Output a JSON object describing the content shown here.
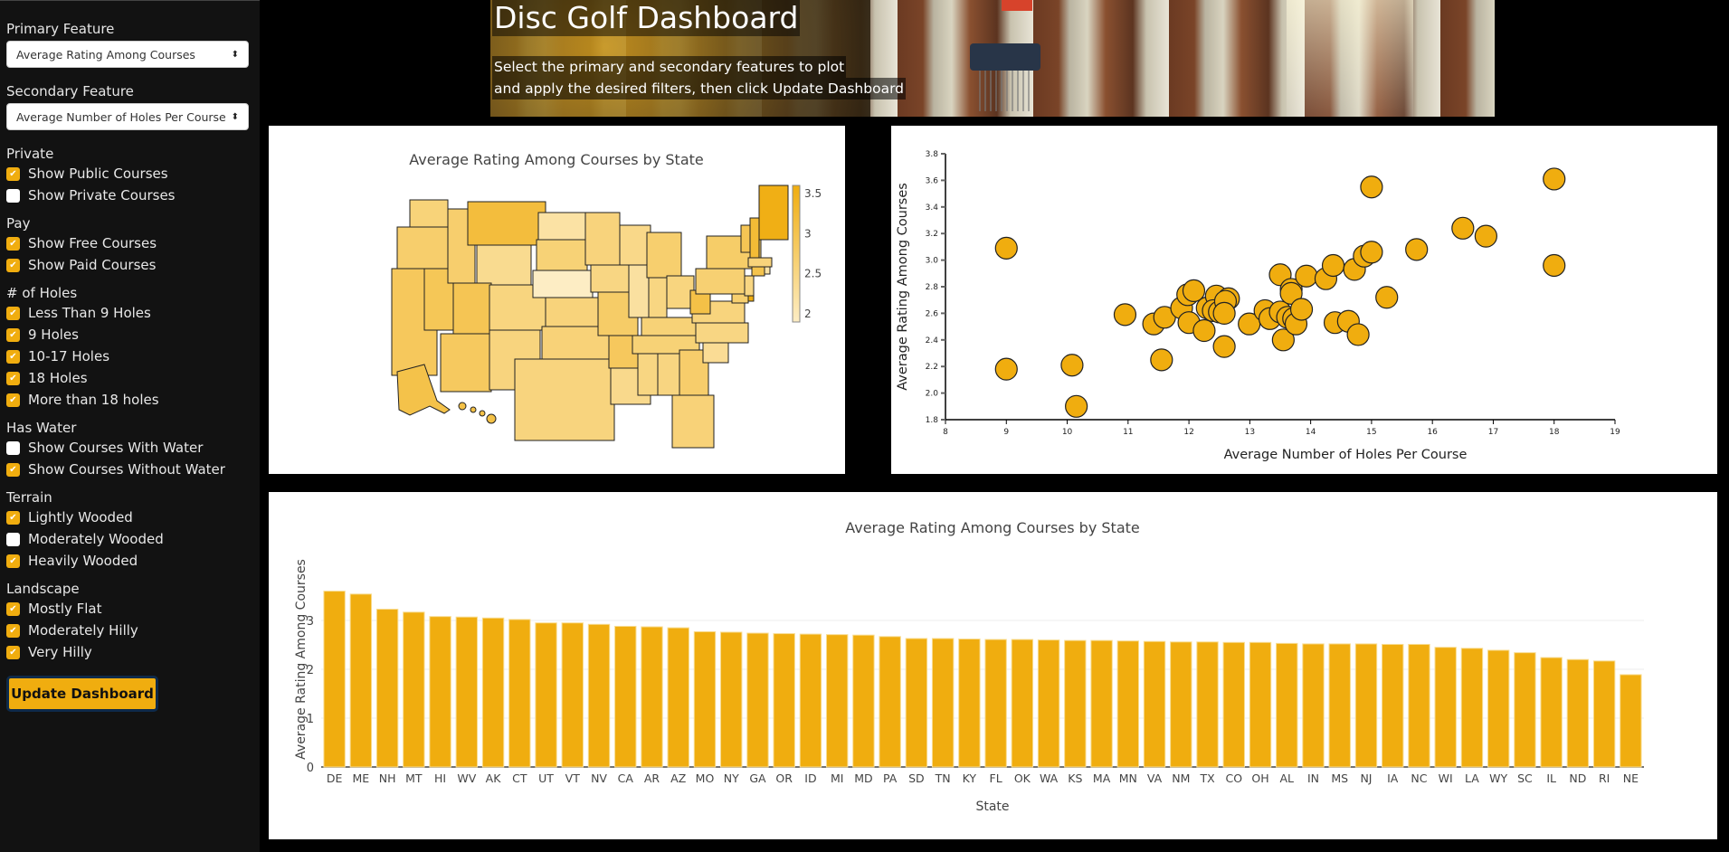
{
  "sidebar": {
    "primary_label": "Primary Feature",
    "primary_value": "Average Rating Among Courses",
    "secondary_label": "Secondary Feature",
    "secondary_value": "Average Number of Holes Per Course",
    "groups": [
      {
        "label": "Private",
        "items": [
          {
            "label": "Show Public Courses",
            "checked": true
          },
          {
            "label": "Show Private Courses",
            "checked": false
          }
        ]
      },
      {
        "label": "Pay",
        "items": [
          {
            "label": "Show Free Courses",
            "checked": true
          },
          {
            "label": "Show Paid Courses",
            "checked": true
          }
        ]
      },
      {
        "label": "# of Holes",
        "items": [
          {
            "label": "Less Than 9 Holes",
            "checked": true
          },
          {
            "label": "9 Holes",
            "checked": true
          },
          {
            "label": "10-17 Holes",
            "checked": true
          },
          {
            "label": "18 Holes",
            "checked": true
          },
          {
            "label": "More than 18 holes",
            "checked": true
          }
        ]
      },
      {
        "label": "Has Water",
        "items": [
          {
            "label": "Show Courses With Water",
            "checked": false
          },
          {
            "label": "Show Courses Without Water",
            "checked": true
          }
        ]
      },
      {
        "label": "Terrain",
        "items": [
          {
            "label": "Lightly Wooded",
            "checked": true
          },
          {
            "label": "Moderately Wooded",
            "checked": false
          },
          {
            "label": "Heavily Wooded",
            "checked": true
          }
        ]
      },
      {
        "label": "Landscape",
        "items": [
          {
            "label": "Mostly Flat",
            "checked": true
          },
          {
            "label": "Moderately Hilly",
            "checked": true
          },
          {
            "label": "Very Hilly",
            "checked": true
          }
        ]
      }
    ],
    "update_button": "Update Dashboard"
  },
  "banner": {
    "title": "Disc Golf Dashboard",
    "subtitle_line1": "Select the primary and secondary features to plot",
    "subtitle_line2": "and apply the desired filters, then click Update Dashboard"
  },
  "colors": {
    "accent": "#f0ad0f",
    "map_low": "#fdedc4",
    "map_high": "#f0ad0f"
  },
  "chart_data": [
    {
      "type": "choropleth",
      "title": "Average Rating Among Courses by State",
      "colorbar": {
        "ticks": [
          "3.5",
          "3",
          "2.5",
          "2"
        ],
        "range": [
          1.9,
          3.6
        ]
      },
      "note": "US states colored by the same values as the bar chart"
    },
    {
      "type": "scatter",
      "title": "",
      "xlabel": "Average Number of Holes Per Course",
      "ylabel": "Average Rating Among Courses",
      "xlim": [
        8,
        19
      ],
      "ylim": [
        1.8,
        3.8
      ],
      "xticks": [
        "8",
        "9",
        "10",
        "11",
        "12",
        "13",
        "14",
        "15",
        "16",
        "17",
        "18",
        "19"
      ],
      "yticks": [
        "1.8",
        "2.0",
        "2.2",
        "2.4",
        "2.6",
        "2.8",
        "3.0",
        "3.2",
        "3.4",
        "3.6",
        "3.8"
      ],
      "points": [
        [
          9.0,
          3.09
        ],
        [
          9.0,
          2.18
        ],
        [
          10.08,
          2.21
        ],
        [
          10.15,
          1.9
        ],
        [
          10.95,
          2.59
        ],
        [
          11.42,
          2.52
        ],
        [
          11.55,
          2.25
        ],
        [
          11.6,
          2.57
        ],
        [
          11.88,
          2.64
        ],
        [
          11.98,
          2.74
        ],
        [
          12.08,
          2.77
        ],
        [
          12.0,
          2.53
        ],
        [
          12.25,
          2.47
        ],
        [
          12.3,
          2.64
        ],
        [
          12.45,
          2.73
        ],
        [
          12.4,
          2.62
        ],
        [
          12.5,
          2.61
        ],
        [
          12.65,
          2.71
        ],
        [
          12.6,
          2.69
        ],
        [
          12.58,
          2.6
        ],
        [
          12.58,
          2.35
        ],
        [
          12.99,
          2.52
        ],
        [
          13.25,
          2.62
        ],
        [
          13.33,
          2.56
        ],
        [
          13.5,
          2.89
        ],
        [
          13.5,
          2.61
        ],
        [
          13.55,
          2.4
        ],
        [
          13.62,
          2.57
        ],
        [
          13.68,
          2.78
        ],
        [
          13.68,
          2.75
        ],
        [
          13.72,
          2.56
        ],
        [
          13.76,
          2.52
        ],
        [
          13.85,
          2.63
        ],
        [
          13.93,
          2.88
        ],
        [
          14.25,
          2.86
        ],
        [
          14.37,
          2.96
        ],
        [
          14.4,
          2.53
        ],
        [
          14.62,
          2.54
        ],
        [
          14.72,
          2.93
        ],
        [
          14.78,
          2.44
        ],
        [
          14.88,
          3.03
        ],
        [
          15.0,
          3.06
        ],
        [
          15.0,
          3.55
        ],
        [
          15.25,
          2.72
        ],
        [
          15.74,
          3.08
        ],
        [
          16.5,
          3.24
        ],
        [
          16.88,
          3.18
        ],
        [
          18.0,
          3.61
        ],
        [
          18.0,
          2.96
        ]
      ]
    },
    {
      "type": "bar",
      "title": "Average Rating Among Courses by State",
      "xlabel": "State",
      "ylabel": "Average Rating Among Courses",
      "ylim": [
        0,
        3.75
      ],
      "yticks": [
        "0",
        "1",
        "2",
        "3"
      ],
      "categories": [
        "DE",
        "ME",
        "NH",
        "MT",
        "HI",
        "WV",
        "AK",
        "CT",
        "UT",
        "VT",
        "NV",
        "CA",
        "AR",
        "AZ",
        "MO",
        "NY",
        "GA",
        "OR",
        "ID",
        "MI",
        "MD",
        "PA",
        "SD",
        "TN",
        "KY",
        "FL",
        "OK",
        "WA",
        "KS",
        "MA",
        "MN",
        "VA",
        "NM",
        "TX",
        "CO",
        "OH",
        "AL",
        "IN",
        "MS",
        "NJ",
        "IA",
        "NC",
        "WI",
        "LA",
        "WY",
        "SC",
        "IL",
        "ND",
        "RI",
        "NE"
      ],
      "values": [
        3.6,
        3.54,
        3.23,
        3.17,
        3.08,
        3.07,
        3.05,
        3.02,
        2.95,
        2.95,
        2.92,
        2.88,
        2.87,
        2.85,
        2.77,
        2.76,
        2.74,
        2.73,
        2.72,
        2.71,
        2.7,
        2.67,
        2.63,
        2.63,
        2.62,
        2.61,
        2.61,
        2.6,
        2.59,
        2.59,
        2.58,
        2.57,
        2.56,
        2.56,
        2.55,
        2.55,
        2.53,
        2.52,
        2.52,
        2.52,
        2.51,
        2.51,
        2.45,
        2.43,
        2.39,
        2.34,
        2.24,
        2.2,
        2.17,
        1.89
      ]
    }
  ]
}
